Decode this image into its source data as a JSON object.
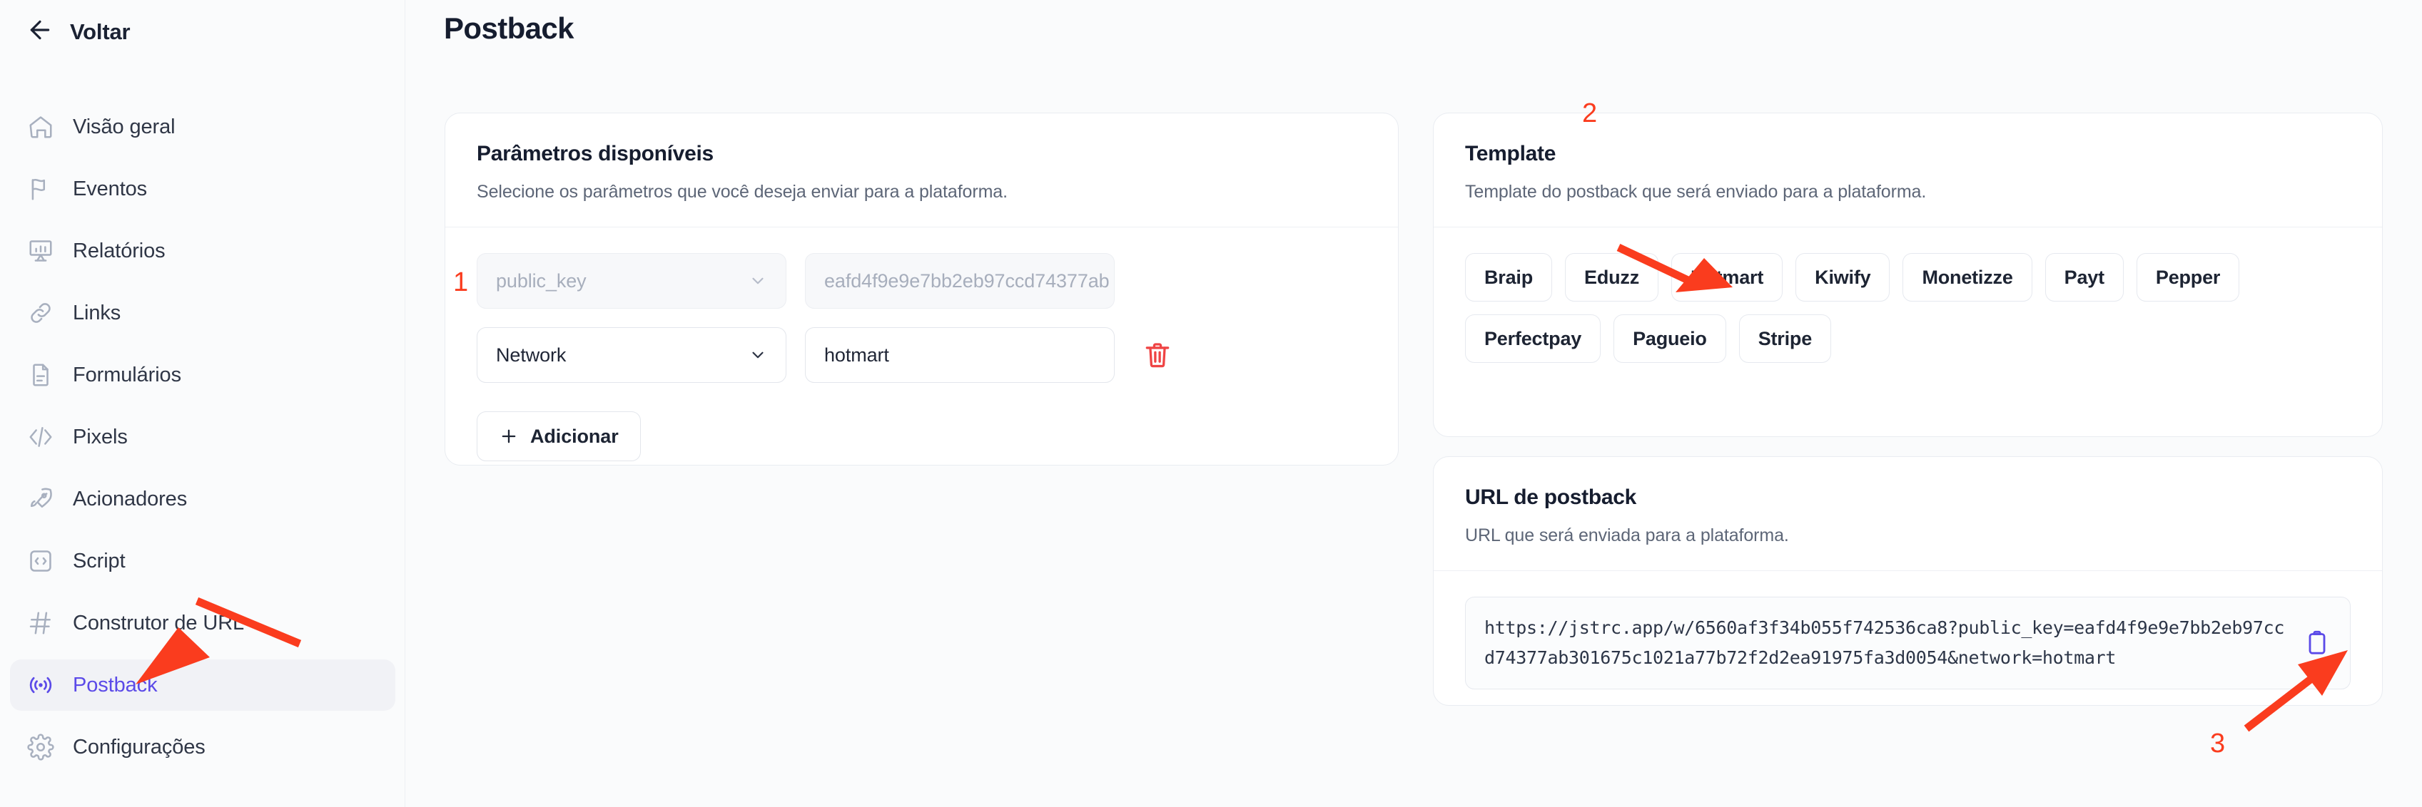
{
  "sidebar": {
    "back_label": "Voltar",
    "items": [
      {
        "label": "Visão geral",
        "icon": "home-icon",
        "active": false
      },
      {
        "label": "Eventos",
        "icon": "flag-icon",
        "active": false
      },
      {
        "label": "Relatórios",
        "icon": "presentation-chart-icon",
        "active": false
      },
      {
        "label": "Links",
        "icon": "link-icon",
        "active": false
      },
      {
        "label": "Formulários",
        "icon": "document-icon",
        "active": false
      },
      {
        "label": "Pixels",
        "icon": "code-slash-icon",
        "active": false
      },
      {
        "label": "Acionadores",
        "icon": "rocket-icon",
        "active": false
      },
      {
        "label": "Script",
        "icon": "code-box-icon",
        "active": false
      },
      {
        "label": "Construtor de URL",
        "icon": "hash-icon",
        "active": false
      },
      {
        "label": "Postback",
        "icon": "broadcast-icon",
        "active": true
      },
      {
        "label": "Configurações",
        "icon": "gear-icon",
        "active": false
      }
    ]
  },
  "header": {
    "title": "Postback"
  },
  "params_card": {
    "title": "Parâmetros disponíveis",
    "subtitle": "Selecione os parâmetros que você deseja enviar para a plataforma.",
    "rows": [
      {
        "key": "public_key",
        "value": "eafd4f9e9e7bb2eb97ccd74377ab",
        "disabled": true,
        "deletable": false
      },
      {
        "key": "Network",
        "value": "hotmart",
        "disabled": false,
        "deletable": true
      }
    ],
    "add_label": "Adicionar"
  },
  "template_card": {
    "title": "Template",
    "subtitle": "Template do postback que será enviado para a plataforma.",
    "chips": [
      "Braip",
      "Eduzz",
      "Hotmart",
      "Kiwify",
      "Monetizze",
      "Payt",
      "Pepper",
      "Perfectpay",
      "Pagueio",
      "Stripe"
    ]
  },
  "url_card": {
    "title": "URL de postback",
    "subtitle": "URL que será enviada para a plataforma.",
    "url": "https://jstrc.app/w/6560af3f34b055f742536ca8?public_key=eafd4f9e9e7bb2eb97ccd74377ab301675c1021a77b72f2d2ea91975fa3d0054&network=hotmart",
    "copy_icon": "clipboard-icon"
  },
  "annotations": {
    "markers": [
      "1",
      "2",
      "3"
    ],
    "color": "#fa3c1e"
  },
  "colors": {
    "accent": "#5b4ae8",
    "danger": "#ef4444",
    "annotation": "#fa3c1e",
    "text": "#161d2f",
    "muted": "#5d6677",
    "page_bg": "#fafbfc"
  }
}
